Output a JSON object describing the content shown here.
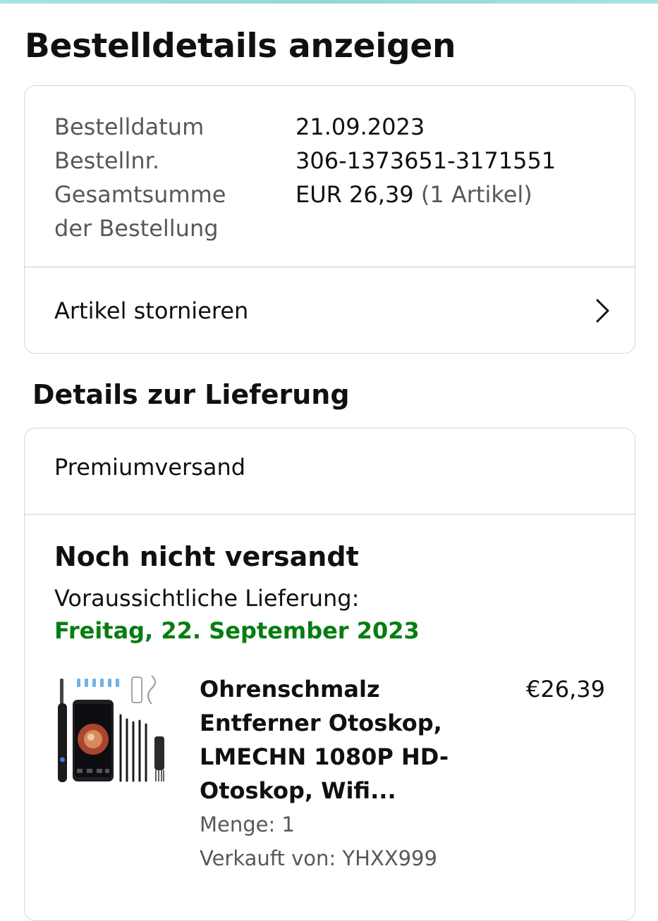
{
  "page": {
    "title": "Bestelldetails anzeigen"
  },
  "order_summary": {
    "rows": [
      {
        "label": "Bestelldatum",
        "value": "21.09.2023"
      },
      {
        "label": "Bestellnr.",
        "value": "306-1373651-3171551"
      },
      {
        "label": "Gesamtsumme der Bestellung",
        "value": "EUR 26,39",
        "extra": "(1 Artikel)"
      }
    ],
    "cancel_label": "Artikel stornieren"
  },
  "delivery": {
    "section_title": "Details zur Lieferung",
    "shipping_method": "Premiumversand",
    "status": "Noch nicht versandt",
    "eta_label": "Voraussichtliche Lieferung:",
    "eta_date": "Freitag, 22. September 2023"
  },
  "product": {
    "title": "Ohrenschmalz Entferner Otoskop, LMECHN 1080P HD-Otoskop, Wifi...",
    "price": "€26,39",
    "quantity": "Menge: 1",
    "seller": "Verkauft von: YHXX999"
  },
  "icons": {
    "chevron": "chevron-right-icon"
  },
  "colors": {
    "accent_green": "#067d12",
    "top_accent": "#a6e4df"
  }
}
